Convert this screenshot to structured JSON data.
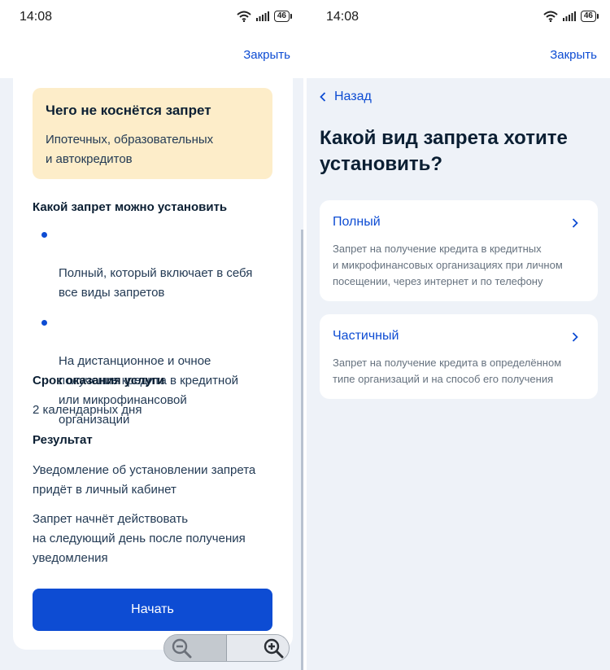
{
  "left": {
    "status": {
      "time": "14:08",
      "battery": "46"
    },
    "close_label": "Закрыть",
    "info_box": {
      "title": "Чего не коснётся запрет",
      "text": "Ипотечных, образовательных\nи автокредитов"
    },
    "types_heading": "Какой запрет можно установить",
    "bullets": [
      "Полный, который включает в себя\nвсе виды запретов",
      "На дистанционное и очное\nполучение кредита в кредитной\nили микрофинансовой\nорганизации"
    ],
    "term_heading": "Срок оказания услуги",
    "term_text": "2 календарных дня",
    "result_heading": "Результат",
    "result_text_1": "Уведомление об установлении запрета\nпридёт в личный кабинет",
    "result_text_2": "Запрет начнёт действовать\nна следующий день после получения\nуведомления",
    "start_button": "Начать"
  },
  "right": {
    "status": {
      "time": "14:08",
      "battery": "46"
    },
    "close_label": "Закрыть",
    "back_label": "Назад",
    "title": "Какой вид запрета хотите\nустановить?",
    "options": [
      {
        "title": "Полный",
        "description": "Запрет на получение кредита в кредитных\nи микрофинансовых организациях при личном\nпосещении, через интернет и по телефону"
      },
      {
        "title": "Частичный",
        "description": "Запрет на получение кредита в определённом\nтипе организаций и на способ его получения"
      }
    ]
  },
  "colors": {
    "accent": "#0d4cd3",
    "info_box_bg": "#fdedc9",
    "page_bg": "#eef2f8",
    "text": "#0b1f33"
  },
  "icons": [
    "wifi-icon",
    "signal-icon",
    "battery-icon",
    "zoom-out-icon",
    "zoom-in-icon",
    "chevron-left-icon",
    "chevron-right-icon"
  ]
}
